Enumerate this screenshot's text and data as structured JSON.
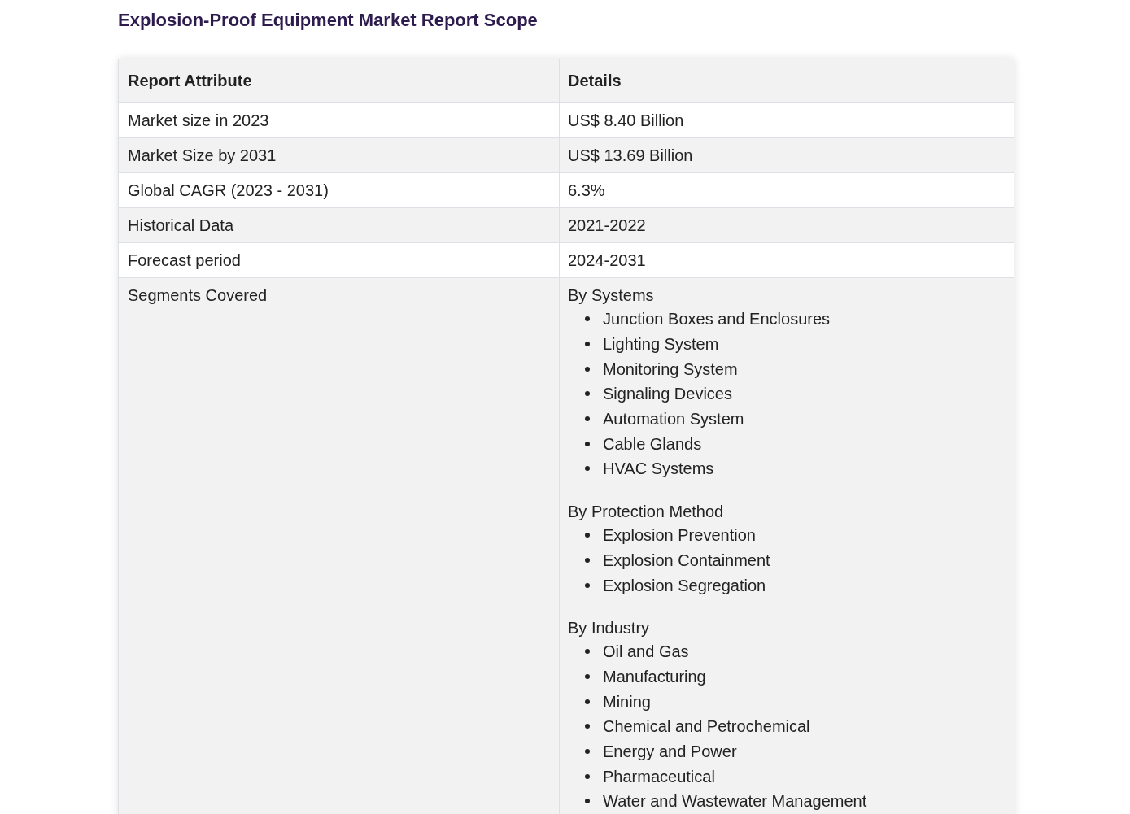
{
  "heading": "Explosion-Proof Equipment Market Report Scope",
  "table": {
    "columns": [
      "Report Attribute",
      "Details"
    ],
    "rows": [
      {
        "kind": "text",
        "attribute": "Market size in 2023",
        "details": "US$ 8.40 Billion"
      },
      {
        "kind": "text",
        "attribute": "Market Size by 2031",
        "details": "US$ 13.69 Billion"
      },
      {
        "kind": "text",
        "attribute": "Global CAGR (2023 - 2031)",
        "details": "6.3%"
      },
      {
        "kind": "text",
        "attribute": "Historical Data",
        "details": "2021-2022"
      },
      {
        "kind": "text",
        "attribute": "Forecast period",
        "details": "2024-2031"
      },
      {
        "kind": "segments",
        "attribute": "Segments Covered",
        "segments": [
          {
            "title": "By Systems",
            "items": [
              "Junction Boxes and Enclosures",
              "Lighting System",
              "Monitoring System",
              "Signaling Devices",
              "Automation System",
              "Cable Glands",
              "HVAC Systems"
            ]
          },
          {
            "title": "By Protection Method",
            "items": [
              "Explosion Prevention",
              "Explosion Containment",
              "Explosion Segregation"
            ]
          },
          {
            "title": "By Industry",
            "items": [
              "Oil and Gas",
              "Manufacturing",
              "Mining",
              "Chemical and Petrochemical",
              "Energy and Power",
              "Pharmaceutical",
              "Water and Wastewater Management"
            ]
          }
        ]
      }
    ]
  }
}
